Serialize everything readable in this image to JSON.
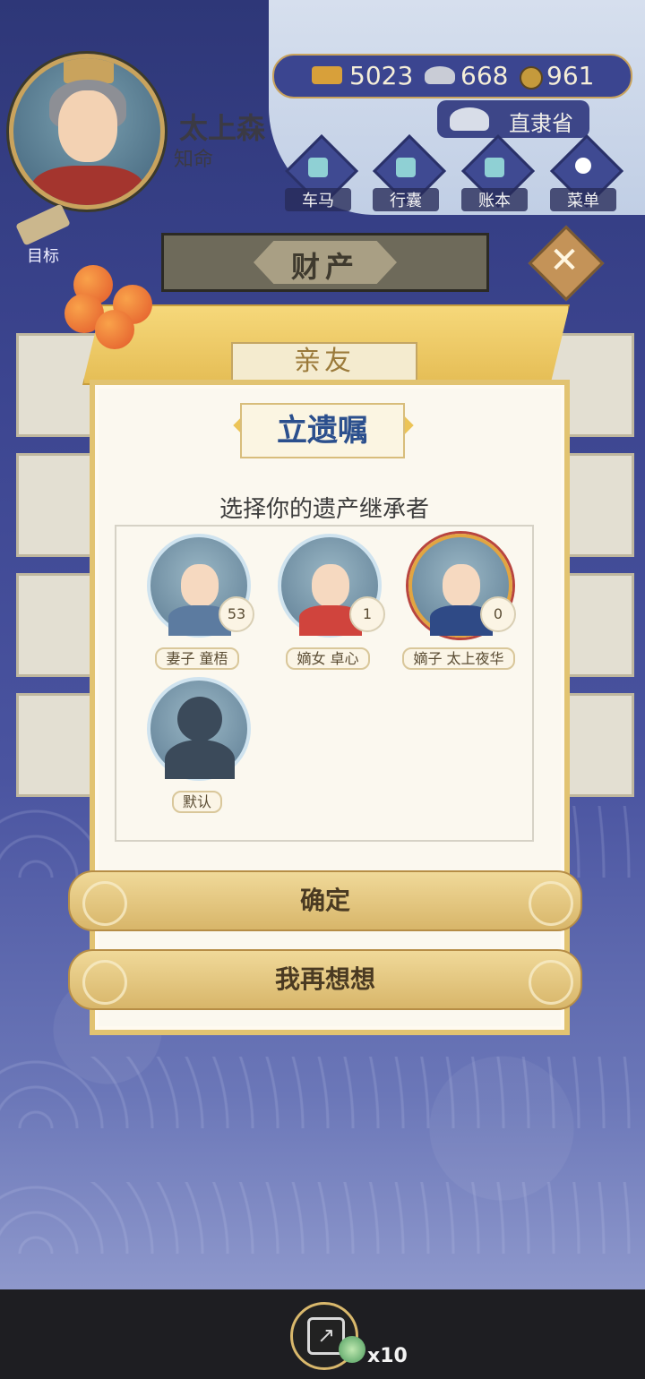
{
  "header": {
    "player_name": "太上森",
    "player_title": "知命",
    "currency": {
      "gold": "5023",
      "silver": "668",
      "coin": "961"
    },
    "province": "直隶省",
    "menu": [
      {
        "label": "车马",
        "icon": "carriage-icon"
      },
      {
        "label": "行囊",
        "icon": "bag-icon"
      },
      {
        "label": "账本",
        "icon": "ledger-icon"
      },
      {
        "label": "菜单",
        "icon": "more-icon"
      }
    ],
    "goal_label": "目标",
    "section_title": "财产"
  },
  "dialog": {
    "tab_label": "亲友",
    "title": "立遗嘱",
    "instruction": "选择你的遗产继承者",
    "heirs": [
      {
        "name": "妻子 童梧",
        "age": "53"
      },
      {
        "name": "嫡女 卓心",
        "age": "1"
      },
      {
        "name": "嫡子 太上夜华",
        "age": "0"
      },
      {
        "name": "默认",
        "age": ""
      }
    ],
    "confirm_label": "确定",
    "cancel_label": "我再想想"
  },
  "footer": {
    "share_count": "x10"
  },
  "colors": {
    "background": "#3b4287",
    "accent_gold": "#e2c371",
    "title_blue": "#2b4f8d"
  }
}
